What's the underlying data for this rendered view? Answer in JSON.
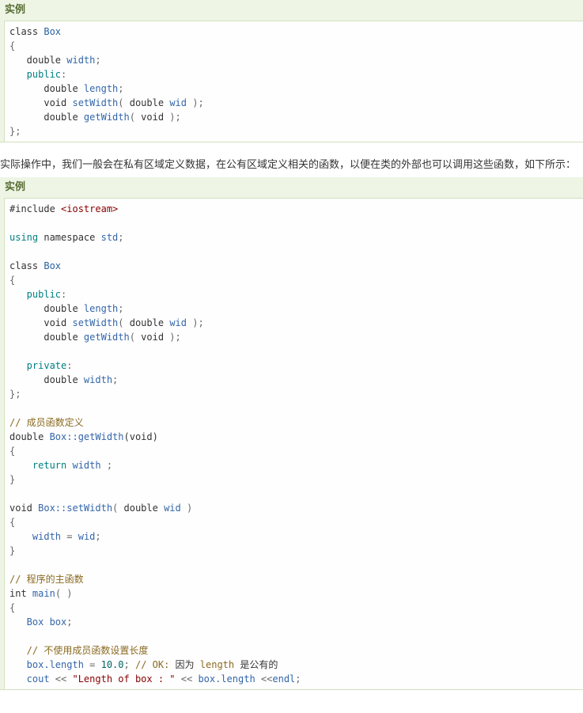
{
  "example1": {
    "header": "实例",
    "lines": [
      [
        {
          "t": "class ",
          "c": "kw"
        },
        {
          "t": "Box",
          "c": "typ"
        }
      ],
      [
        {
          "t": "{",
          "c": "pun"
        }
      ],
      [
        {
          "t": "   double ",
          "c": "kw"
        },
        {
          "t": "width",
          "c": "fn"
        },
        {
          "t": ";",
          "c": "pun"
        }
      ],
      [
        {
          "t": "   public",
          "c": "k2"
        },
        {
          "t": ":",
          "c": "pun"
        }
      ],
      [
        {
          "t": "      double ",
          "c": "kw"
        },
        {
          "t": "length",
          "c": "fn"
        },
        {
          "t": ";",
          "c": "pun"
        }
      ],
      [
        {
          "t": "      void ",
          "c": "kw"
        },
        {
          "t": "setWidth",
          "c": "fn"
        },
        {
          "t": "( ",
          "c": "pun"
        },
        {
          "t": "double ",
          "c": "kw"
        },
        {
          "t": "wid",
          "c": "fn"
        },
        {
          "t": " );",
          "c": "pun"
        }
      ],
      [
        {
          "t": "      double ",
          "c": "kw"
        },
        {
          "t": "getWidth",
          "c": "fn"
        },
        {
          "t": "( ",
          "c": "pun"
        },
        {
          "t": "void",
          "c": "kw"
        },
        {
          "t": " );",
          "c": "pun"
        }
      ],
      [
        {
          "t": "};",
          "c": "pun"
        }
      ]
    ]
  },
  "paragraph": "实际操作中，我们一般会在私有区域定义数据，在公有区域定义相关的函数，以便在类的外部也可以调用这些函数，如下所示：",
  "example2": {
    "header": "实例",
    "lines": [
      [
        {
          "t": "#include ",
          "c": "pp"
        },
        {
          "t": "<iostream>",
          "c": "str"
        }
      ],
      [],
      [
        {
          "t": "using",
          "c": "k2"
        },
        {
          "t": " namespace ",
          "c": "kw"
        },
        {
          "t": "std",
          "c": "fn"
        },
        {
          "t": ";",
          "c": "pun"
        }
      ],
      [],
      [
        {
          "t": "class ",
          "c": "kw"
        },
        {
          "t": "Box",
          "c": "typ"
        }
      ],
      [
        {
          "t": "{",
          "c": "pun"
        }
      ],
      [
        {
          "t": "   public",
          "c": "k2"
        },
        {
          "t": ":",
          "c": "pun"
        }
      ],
      [
        {
          "t": "      double ",
          "c": "kw"
        },
        {
          "t": "length",
          "c": "fn"
        },
        {
          "t": ";",
          "c": "pun"
        }
      ],
      [
        {
          "t": "      void ",
          "c": "kw"
        },
        {
          "t": "setWidth",
          "c": "fn"
        },
        {
          "t": "( ",
          "c": "pun"
        },
        {
          "t": "double ",
          "c": "kw"
        },
        {
          "t": "wid",
          "c": "fn"
        },
        {
          "t": " );",
          "c": "pun"
        }
      ],
      [
        {
          "t": "      double ",
          "c": "kw"
        },
        {
          "t": "getWidth",
          "c": "fn"
        },
        {
          "t": "( ",
          "c": "pun"
        },
        {
          "t": "void",
          "c": "kw"
        },
        {
          "t": " );",
          "c": "pun"
        }
      ],
      [],
      [
        {
          "t": "   private",
          "c": "k2"
        },
        {
          "t": ":",
          "c": "pun"
        }
      ],
      [
        {
          "t": "      double ",
          "c": "kw"
        },
        {
          "t": "width",
          "c": "fn"
        },
        {
          "t": ";",
          "c": "pun"
        }
      ],
      [
        {
          "t": "};",
          "c": "pun"
        }
      ],
      [],
      [
        {
          "t": "// 成员函数定义",
          "c": "com"
        }
      ],
      [
        {
          "t": "double ",
          "c": "kw"
        },
        {
          "t": "Box::getWidth",
          "c": "fn"
        },
        {
          "t": "(void)",
          "c": "kw"
        }
      ],
      [
        {
          "t": "{",
          "c": "pun"
        }
      ],
      [
        {
          "t": "    return ",
          "c": "k2"
        },
        {
          "t": "width",
          "c": "fn"
        },
        {
          "t": " ;",
          "c": "pun"
        }
      ],
      [
        {
          "t": "}",
          "c": "pun"
        }
      ],
      [],
      [
        {
          "t": "void ",
          "c": "kw"
        },
        {
          "t": "Box::setWidth",
          "c": "fn"
        },
        {
          "t": "( ",
          "c": "pun"
        },
        {
          "t": "double ",
          "c": "kw"
        },
        {
          "t": "wid",
          "c": "fn"
        },
        {
          "t": " )",
          "c": "pun"
        }
      ],
      [
        {
          "t": "{",
          "c": "pun"
        }
      ],
      [
        {
          "t": "    width",
          "c": "fn"
        },
        {
          "t": " = ",
          "c": "pun"
        },
        {
          "t": "wid",
          "c": "fn"
        },
        {
          "t": ";",
          "c": "pun"
        }
      ],
      [
        {
          "t": "}",
          "c": "pun"
        }
      ],
      [],
      [
        {
          "t": "// 程序的主函数",
          "c": "com"
        }
      ],
      [
        {
          "t": "int ",
          "c": "kw"
        },
        {
          "t": "main",
          "c": "fn"
        },
        {
          "t": "( )",
          "c": "pun"
        }
      ],
      [
        {
          "t": "{",
          "c": "pun"
        }
      ],
      [
        {
          "t": "   Box box",
          "c": "fn"
        },
        {
          "t": ";",
          "c": "pun"
        }
      ],
      [],
      [
        {
          "t": "   // 不使用成员函数设置长度",
          "c": "com"
        }
      ],
      [
        {
          "t": "   box.length",
          "c": "fn"
        },
        {
          "t": " = ",
          "c": "pun"
        },
        {
          "t": "10.0",
          "c": "num"
        },
        {
          "t": "; ",
          "c": "pun"
        },
        {
          "t": "// OK: ",
          "c": "com"
        },
        {
          "t": "因为 ",
          "c": "kw"
        },
        {
          "t": "length",
          "c": "com"
        },
        {
          "t": " 是公有的",
          "c": "kw"
        }
      ],
      [
        {
          "t": "   cout",
          "c": "fn"
        },
        {
          "t": " << ",
          "c": "pun"
        },
        {
          "t": "\"Length of box : \"",
          "c": "str"
        },
        {
          "t": " << ",
          "c": "pun"
        },
        {
          "t": "box.length",
          "c": "fn"
        },
        {
          "t": " <<",
          "c": "pun"
        },
        {
          "t": "endl",
          "c": "fn"
        },
        {
          "t": ";",
          "c": "pun"
        }
      ]
    ]
  }
}
